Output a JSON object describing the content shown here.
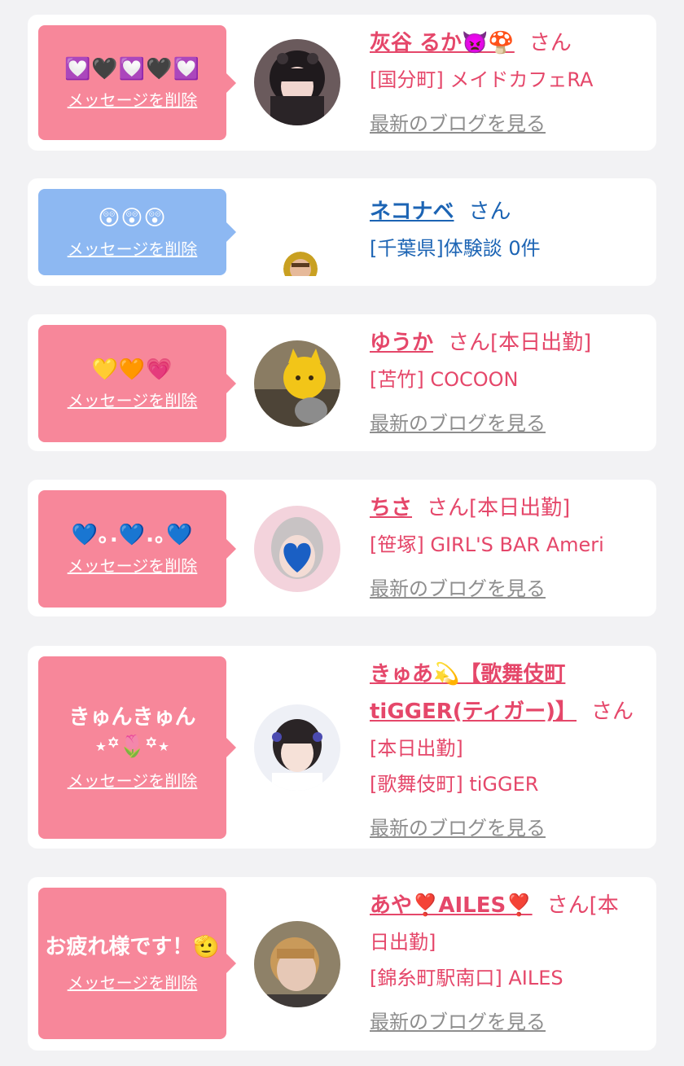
{
  "colors": {
    "pink_bubble": "#f7879a",
    "blue_bubble": "#8db8f2",
    "name_pink": "#e5476a",
    "name_blue": "#1c64b4",
    "link_gray": "#8e8e8e"
  },
  "delete_label": "メッセージを削除",
  "san_label": "さん",
  "blog_label": "最新のブログを見る",
  "cards": [
    {
      "message": "💟🖤💟🖤💟",
      "name": "灰谷 るか👿🍄",
      "status": "",
      "area_shop": "[国分町] メイドカフェRA"
    },
    {
      "message": "😲😲😲",
      "name": "ネコナベ",
      "status": "",
      "area_shop": "[千葉県]体験談 0件"
    },
    {
      "message": "💛🧡💗",
      "name": "ゆうか",
      "status": "[本日出勤]",
      "area_shop": "[苫竹] COCOON"
    },
    {
      "message": "💙｡.💙.｡💙",
      "name": "ちさ",
      "status": "[本日出勤]",
      "area_shop": "[笹塚] GIRL'S BAR Ameri"
    },
    {
      "message": "きゅんきゅん\n⋆꙳🌷꙳⋆",
      "name_line1": "きゅあ💫【歌舞伎町",
      "name_line2": "tiGGER(ティガー)】",
      "status": "[本日出勤]",
      "area_shop": "[歌舞伎町] tiGGER"
    },
    {
      "message": "お疲れ様です！🫡",
      "name": "あや❣️AILES❣️",
      "status_line1": "[本",
      "status_line2": "日出勤]",
      "area_shop": "[錦糸町駅南口] AILES"
    }
  ]
}
